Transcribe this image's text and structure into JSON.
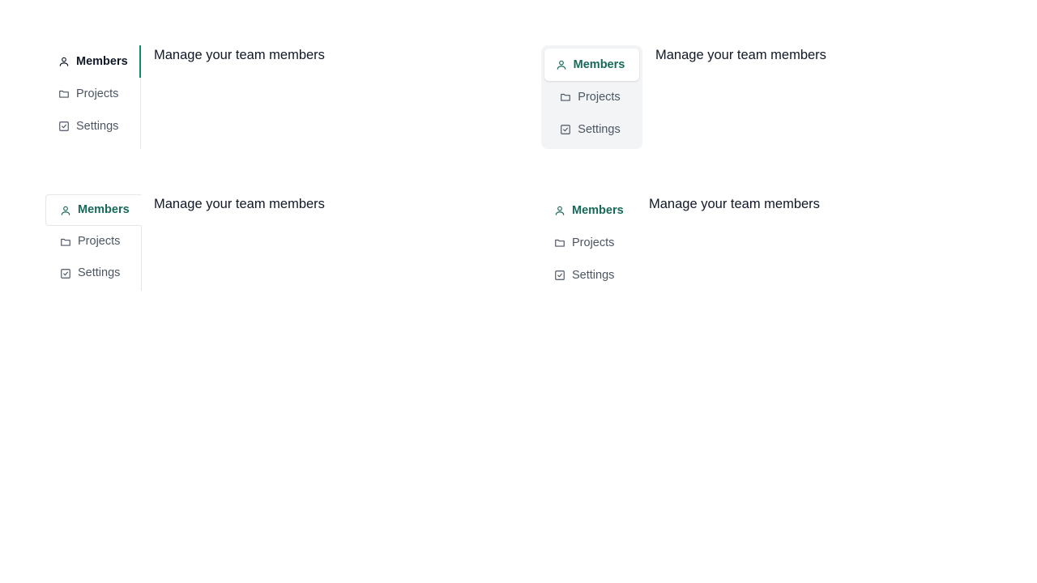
{
  "colors": {
    "accent": "#0f8a6e",
    "accent_text": "#17695a",
    "text": "#111827",
    "muted_text": "#4b5563",
    "border": "#e5e7eb",
    "pill_bg": "#f3f4f6"
  },
  "demos": [
    {
      "variant": "line",
      "tabs": [
        {
          "label": "Members",
          "icon": "user-icon",
          "active": true
        },
        {
          "label": "Projects",
          "icon": "folder-icon",
          "active": false
        },
        {
          "label": "Settings",
          "icon": "checkbox-icon",
          "active": false
        }
      ],
      "panel_text": "Manage your team members"
    },
    {
      "variant": "pills",
      "tabs": [
        {
          "label": "Members",
          "icon": "user-icon",
          "active": true
        },
        {
          "label": "Projects",
          "icon": "folder-icon",
          "active": false
        },
        {
          "label": "Settings",
          "icon": "checkbox-icon",
          "active": false
        }
      ],
      "panel_text": "Manage your team members"
    },
    {
      "variant": "enclosed",
      "tabs": [
        {
          "label": "Members",
          "icon": "user-icon",
          "active": true
        },
        {
          "label": "Projects",
          "icon": "folder-icon",
          "active": false
        },
        {
          "label": "Settings",
          "icon": "checkbox-icon",
          "active": false
        }
      ],
      "panel_text": "Manage your team members"
    },
    {
      "variant": "plain",
      "tabs": [
        {
          "label": "Members",
          "icon": "user-icon",
          "active": true
        },
        {
          "label": "Projects",
          "icon": "folder-icon",
          "active": false
        },
        {
          "label": "Settings",
          "icon": "checkbox-icon",
          "active": false
        }
      ],
      "panel_text": "Manage your team members"
    }
  ]
}
